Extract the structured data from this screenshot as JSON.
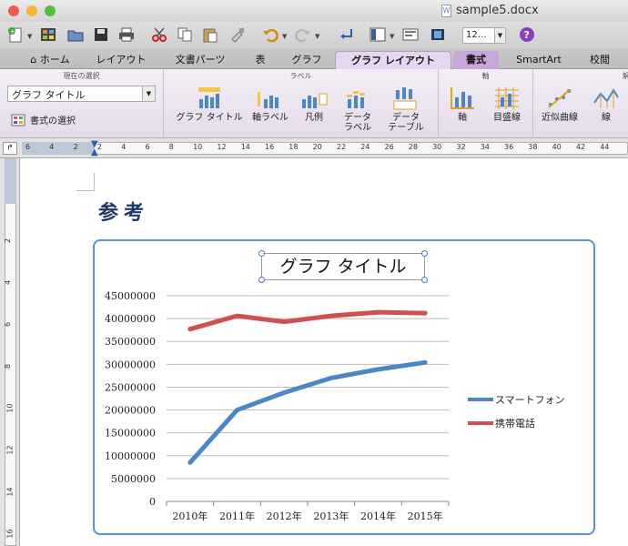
{
  "window": {
    "title": "sample5.docx",
    "traffic_lights": [
      "#ee5a52",
      "#f5b635",
      "#55c13b"
    ]
  },
  "toolbar": {
    "zoom_value": "12…",
    "buttons": [
      "new-doc",
      "templates",
      "open",
      "save",
      "print",
      "cut",
      "copy",
      "paste",
      "format-painter",
      "undo",
      "redo",
      "show-hide",
      "sidebar",
      "gallery",
      "media",
      "help"
    ]
  },
  "tabs": [
    {
      "label": "ホーム",
      "icon": "home-icon"
    },
    {
      "label": "レイアウト"
    },
    {
      "label": "文書パーツ"
    },
    {
      "label": "表"
    },
    {
      "label": "グラフ"
    },
    {
      "label": "グラフ レイアウト",
      "active": true
    },
    {
      "label": "書式",
      "contextual": true
    },
    {
      "label": "SmartArt"
    },
    {
      "label": "校閲"
    }
  ],
  "ribbon": {
    "current_selection": {
      "group_label": "現在の選択",
      "selected": "グラフ タイトル",
      "format_button": "書式の選択"
    },
    "labels_group": {
      "group_label": "ラベル",
      "buttons": [
        "グラフ タイトル",
        "軸ラベル",
        "凡例",
        "データ\nラベル",
        "データ\nテーブル"
      ]
    },
    "axes_group": {
      "group_label": "軸",
      "buttons": [
        "軸",
        "目盛線"
      ]
    },
    "analysis_group": {
      "group_label": "解",
      "buttons": [
        "近似曲線",
        "線"
      ]
    }
  },
  "ruler": {
    "h_numbers": [
      "6",
      "4",
      "2",
      "2",
      "4",
      "6",
      "8",
      "10",
      "12",
      "14",
      "16",
      "18",
      "20",
      "22",
      "24",
      "26",
      "28",
      "30",
      "32",
      "34",
      "36",
      "38",
      "40",
      "42",
      "44"
    ],
    "v_numbers": [
      "2",
      "4",
      "6",
      "8",
      "10",
      "12",
      "14",
      "16"
    ]
  },
  "document": {
    "heading": "参考"
  },
  "chart_data": {
    "type": "line",
    "title": "グラフ タイトル",
    "categories": [
      "2010年",
      "2011年",
      "2012年",
      "2013年",
      "2014年",
      "2015年"
    ],
    "series": [
      {
        "name": "スマートフォン",
        "values": [
          8500000,
          20000000,
          23800000,
          27000000,
          28900000,
          30400000
        ],
        "color": "#4a86c8"
      },
      {
        "name": "携帯電話",
        "values": [
          37700000,
          40600000,
          39300000,
          40600000,
          41400000,
          41200000
        ],
        "color": "#d0504f"
      }
    ],
    "ylim": [
      0,
      45000000
    ],
    "y_ticks": [
      "0",
      "5000000",
      "10000000",
      "15000000",
      "20000000",
      "25000000",
      "30000000",
      "35000000",
      "40000000",
      "45000000"
    ],
    "grid": true,
    "legend": "right"
  }
}
